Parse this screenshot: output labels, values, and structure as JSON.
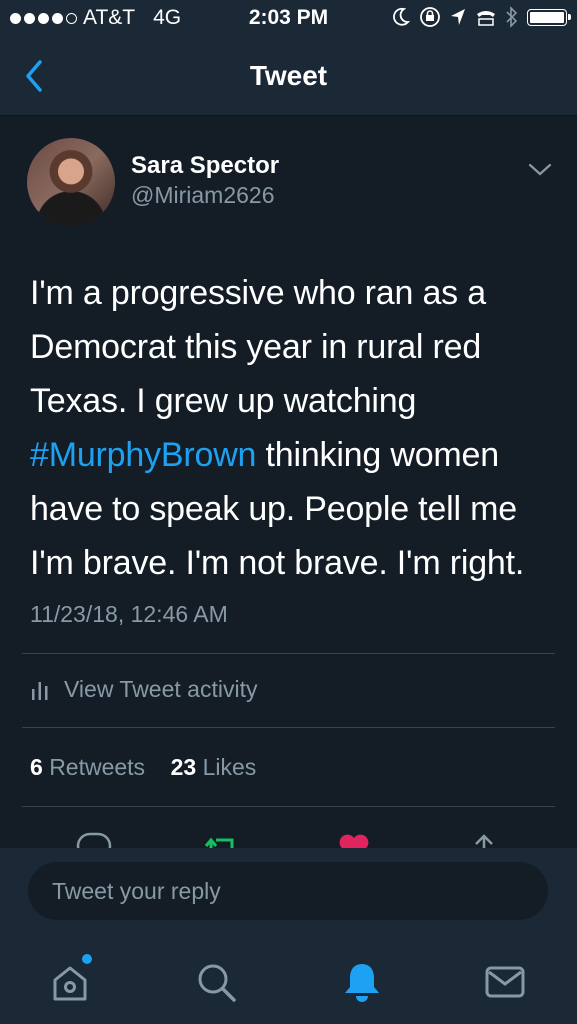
{
  "status_bar": {
    "carrier": "AT&T",
    "network": "4G",
    "time": "2:03 PM"
  },
  "nav": {
    "title": "Tweet"
  },
  "tweet": {
    "author_name": "Sara Spector",
    "author_handle": "@Miriam2626",
    "text_part1": "I'm a progressive who ran as a Democrat this year in rural red Texas. I grew up watching ",
    "hashtag": "#MurphyBrown",
    "text_part2": " thinking women have to speak up. People tell me I'm brave. I'm not brave. I'm right.",
    "timestamp": "11/23/18, 12:46 AM",
    "activity_label": "View Tweet activity",
    "retweet_count": "6",
    "retweet_label": "Retweets",
    "like_count": "23",
    "like_label": "Likes"
  },
  "reply": {
    "placeholder": "Tweet your reply"
  },
  "colors": {
    "background": "#141d26",
    "bar": "#1b2836",
    "accent": "#1da1f2",
    "muted": "#8899a6",
    "retweet": "#17bf63",
    "like": "#e0245e"
  },
  "icons": [
    "back-chevron-icon",
    "chevron-down-icon",
    "activity-bars-icon",
    "reply-icon",
    "retweet-icon",
    "like-icon",
    "share-icon",
    "home-icon",
    "search-icon",
    "notifications-icon",
    "messages-icon"
  ]
}
